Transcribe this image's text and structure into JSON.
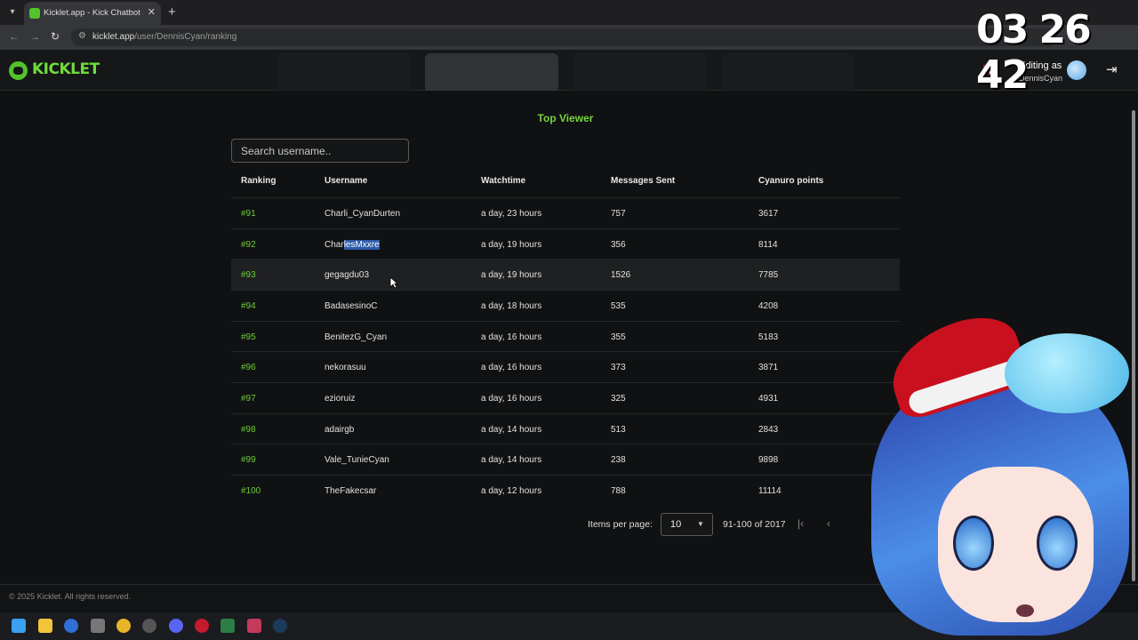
{
  "browser": {
    "tab_title": "Kicklet.app - Kick Chatbot and ",
    "url_host": "kicklet.app",
    "url_path": "/user/DennisCyan/ranking"
  },
  "header": {
    "logo": "KICKLET",
    "editing_label": "Editing as",
    "editing_user": "DennisCyan"
  },
  "page": {
    "section_title": "Top Viewer",
    "search_placeholder": "Search username.."
  },
  "table": {
    "columns": [
      "Ranking",
      "Username",
      "Watchtime",
      "Messages Sent",
      "Cyanuro points"
    ],
    "rows": [
      {
        "rank": "#91",
        "user": "Charli_CyanDurten",
        "watch": "a day, 23 hours",
        "msgs": "757",
        "points": "3617"
      },
      {
        "rank": "#92",
        "user": "CharlesMxxre",
        "watch": "a day, 19 hours",
        "msgs": "356",
        "points": "8114"
      },
      {
        "rank": "#93",
        "user": "gegagdu03",
        "watch": "a day, 19 hours",
        "msgs": "1526",
        "points": "7785"
      },
      {
        "rank": "#94",
        "user": "BadasesinoC",
        "watch": "a day, 18 hours",
        "msgs": "535",
        "points": "4208"
      },
      {
        "rank": "#95",
        "user": "BenitezG_Cyan",
        "watch": "a day, 16 hours",
        "msgs": "355",
        "points": "5183"
      },
      {
        "rank": "#96",
        "user": "nekorasuu",
        "watch": "a day, 16 hours",
        "msgs": "373",
        "points": "3871"
      },
      {
        "rank": "#97",
        "user": "ezioruiz",
        "watch": "a day, 16 hours",
        "msgs": "325",
        "points": "4931"
      },
      {
        "rank": "#98",
        "user": "adairgb",
        "watch": "a day, 14 hours",
        "msgs": "513",
        "points": "2843"
      },
      {
        "rank": "#99",
        "user": "Vale_TunieCyan",
        "watch": "a day, 14 hours",
        "msgs": "238",
        "points": "9898"
      },
      {
        "rank": "#100",
        "user": "TheFakecsar",
        "watch": "a day, 12 hours",
        "msgs": "788",
        "points": "11114"
      }
    ],
    "selected_user_part_1": "Char",
    "selected_user_part_2": "lesMxxre"
  },
  "pagination": {
    "items_label": "Items per page:",
    "items_value": "10",
    "range": "91-100 of 2017"
  },
  "footer": {
    "copyright": "© 2025 Kicklet. All rights reserved."
  },
  "overlay": {
    "clock": "03 26 42"
  },
  "colors": {
    "accent": "#6fdc3c",
    "rank": "#6ccc39",
    "background": "#101112"
  }
}
